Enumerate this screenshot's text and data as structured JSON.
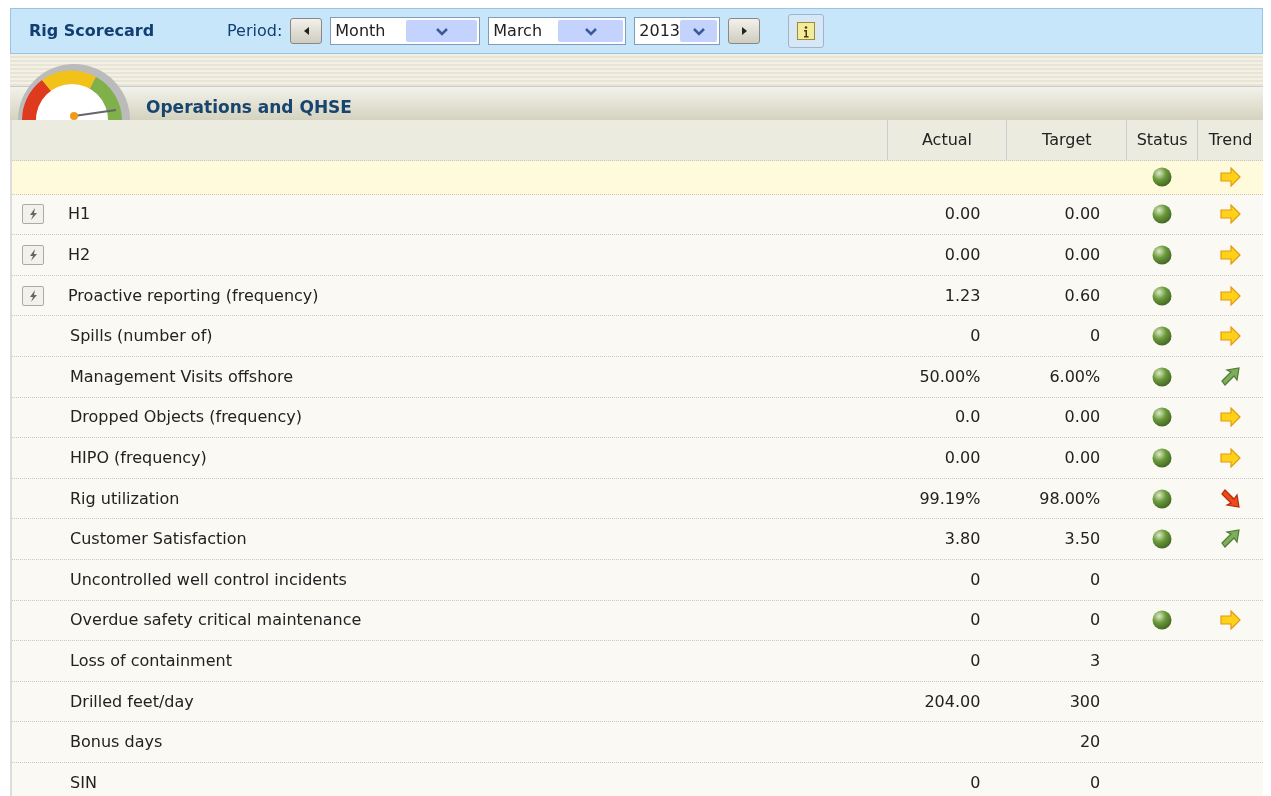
{
  "toolbar": {
    "title": "Rig Scorecard",
    "period_label": "Period:",
    "period_type": "Month",
    "month": "March",
    "year": "2013"
  },
  "section": {
    "title": "Operations and QHSE"
  },
  "columns": [
    "Actual",
    "Target",
    "Status",
    "Trend"
  ],
  "summary": {
    "status": {
      "color": "#6a9a3a"
    },
    "trend": {
      "kind": "flat"
    }
  },
  "rows": [
    {
      "label": "H1",
      "flash_button": true,
      "actual": "0.00",
      "target": "0.00",
      "status": {
        "color": "#6a9a3a"
      },
      "trend": {
        "kind": "flat"
      }
    },
    {
      "label": "H2",
      "flash_button": true,
      "actual": "0.00",
      "target": "0.00",
      "status": {
        "color": "#6a9a3a"
      },
      "trend": {
        "kind": "flat"
      }
    },
    {
      "label": "Proactive reporting (frequency)",
      "flash_button": true,
      "actual": "1.23",
      "target": "0.60",
      "status": {
        "color": "#6a9a3a"
      },
      "trend": {
        "kind": "flat"
      }
    },
    {
      "label": "Spills (number of)",
      "flash_button": false,
      "actual": "0",
      "target": "0",
      "status": {
        "color": "#6a9a3a"
      },
      "trend": {
        "kind": "flat"
      }
    },
    {
      "label": "Management Visits offshore",
      "flash_button": false,
      "actual": "50.00%",
      "target": "6.00%",
      "status": {
        "color": "#6a9a3a"
      },
      "trend": {
        "kind": "up"
      }
    },
    {
      "label": "Dropped Objects (frequency)",
      "flash_button": false,
      "actual": "0.0",
      "target": "0.00",
      "status": {
        "color": "#6a9a3a"
      },
      "trend": {
        "kind": "flat"
      }
    },
    {
      "label": "HIPO (frequency)",
      "flash_button": false,
      "actual": "0.00",
      "target": "0.00",
      "status": {
        "color": "#6a9a3a"
      },
      "trend": {
        "kind": "flat"
      }
    },
    {
      "label": "Rig utilization",
      "flash_button": false,
      "actual": "99.19%",
      "target": "98.00%",
      "status": {
        "color": "#6a9a3a"
      },
      "trend": {
        "kind": "down"
      }
    },
    {
      "label": "Customer Satisfaction",
      "flash_button": false,
      "actual": "3.80",
      "target": "3.50",
      "status": {
        "color": "#6a9a3a"
      },
      "trend": {
        "kind": "up"
      }
    },
    {
      "label": "Uncontrolled well control incidents",
      "flash_button": false,
      "actual": "0",
      "target": "0"
    },
    {
      "label": "Overdue safety critical maintenance",
      "flash_button": false,
      "actual": "0",
      "target": "0",
      "status": {
        "color": "#6a9a3a"
      },
      "trend": {
        "kind": "flat"
      }
    },
    {
      "label": "Loss of containment",
      "flash_button": false,
      "actual": "0",
      "target": "3"
    },
    {
      "label": "Drilled feet/day",
      "flash_button": false,
      "actual": "204.00",
      "target": "300"
    },
    {
      "label": "Bonus days",
      "flash_button": false,
      "target": "20"
    },
    {
      "label": "SIN",
      "flash_button": false,
      "actual": "0",
      "target": "0"
    }
  ]
}
